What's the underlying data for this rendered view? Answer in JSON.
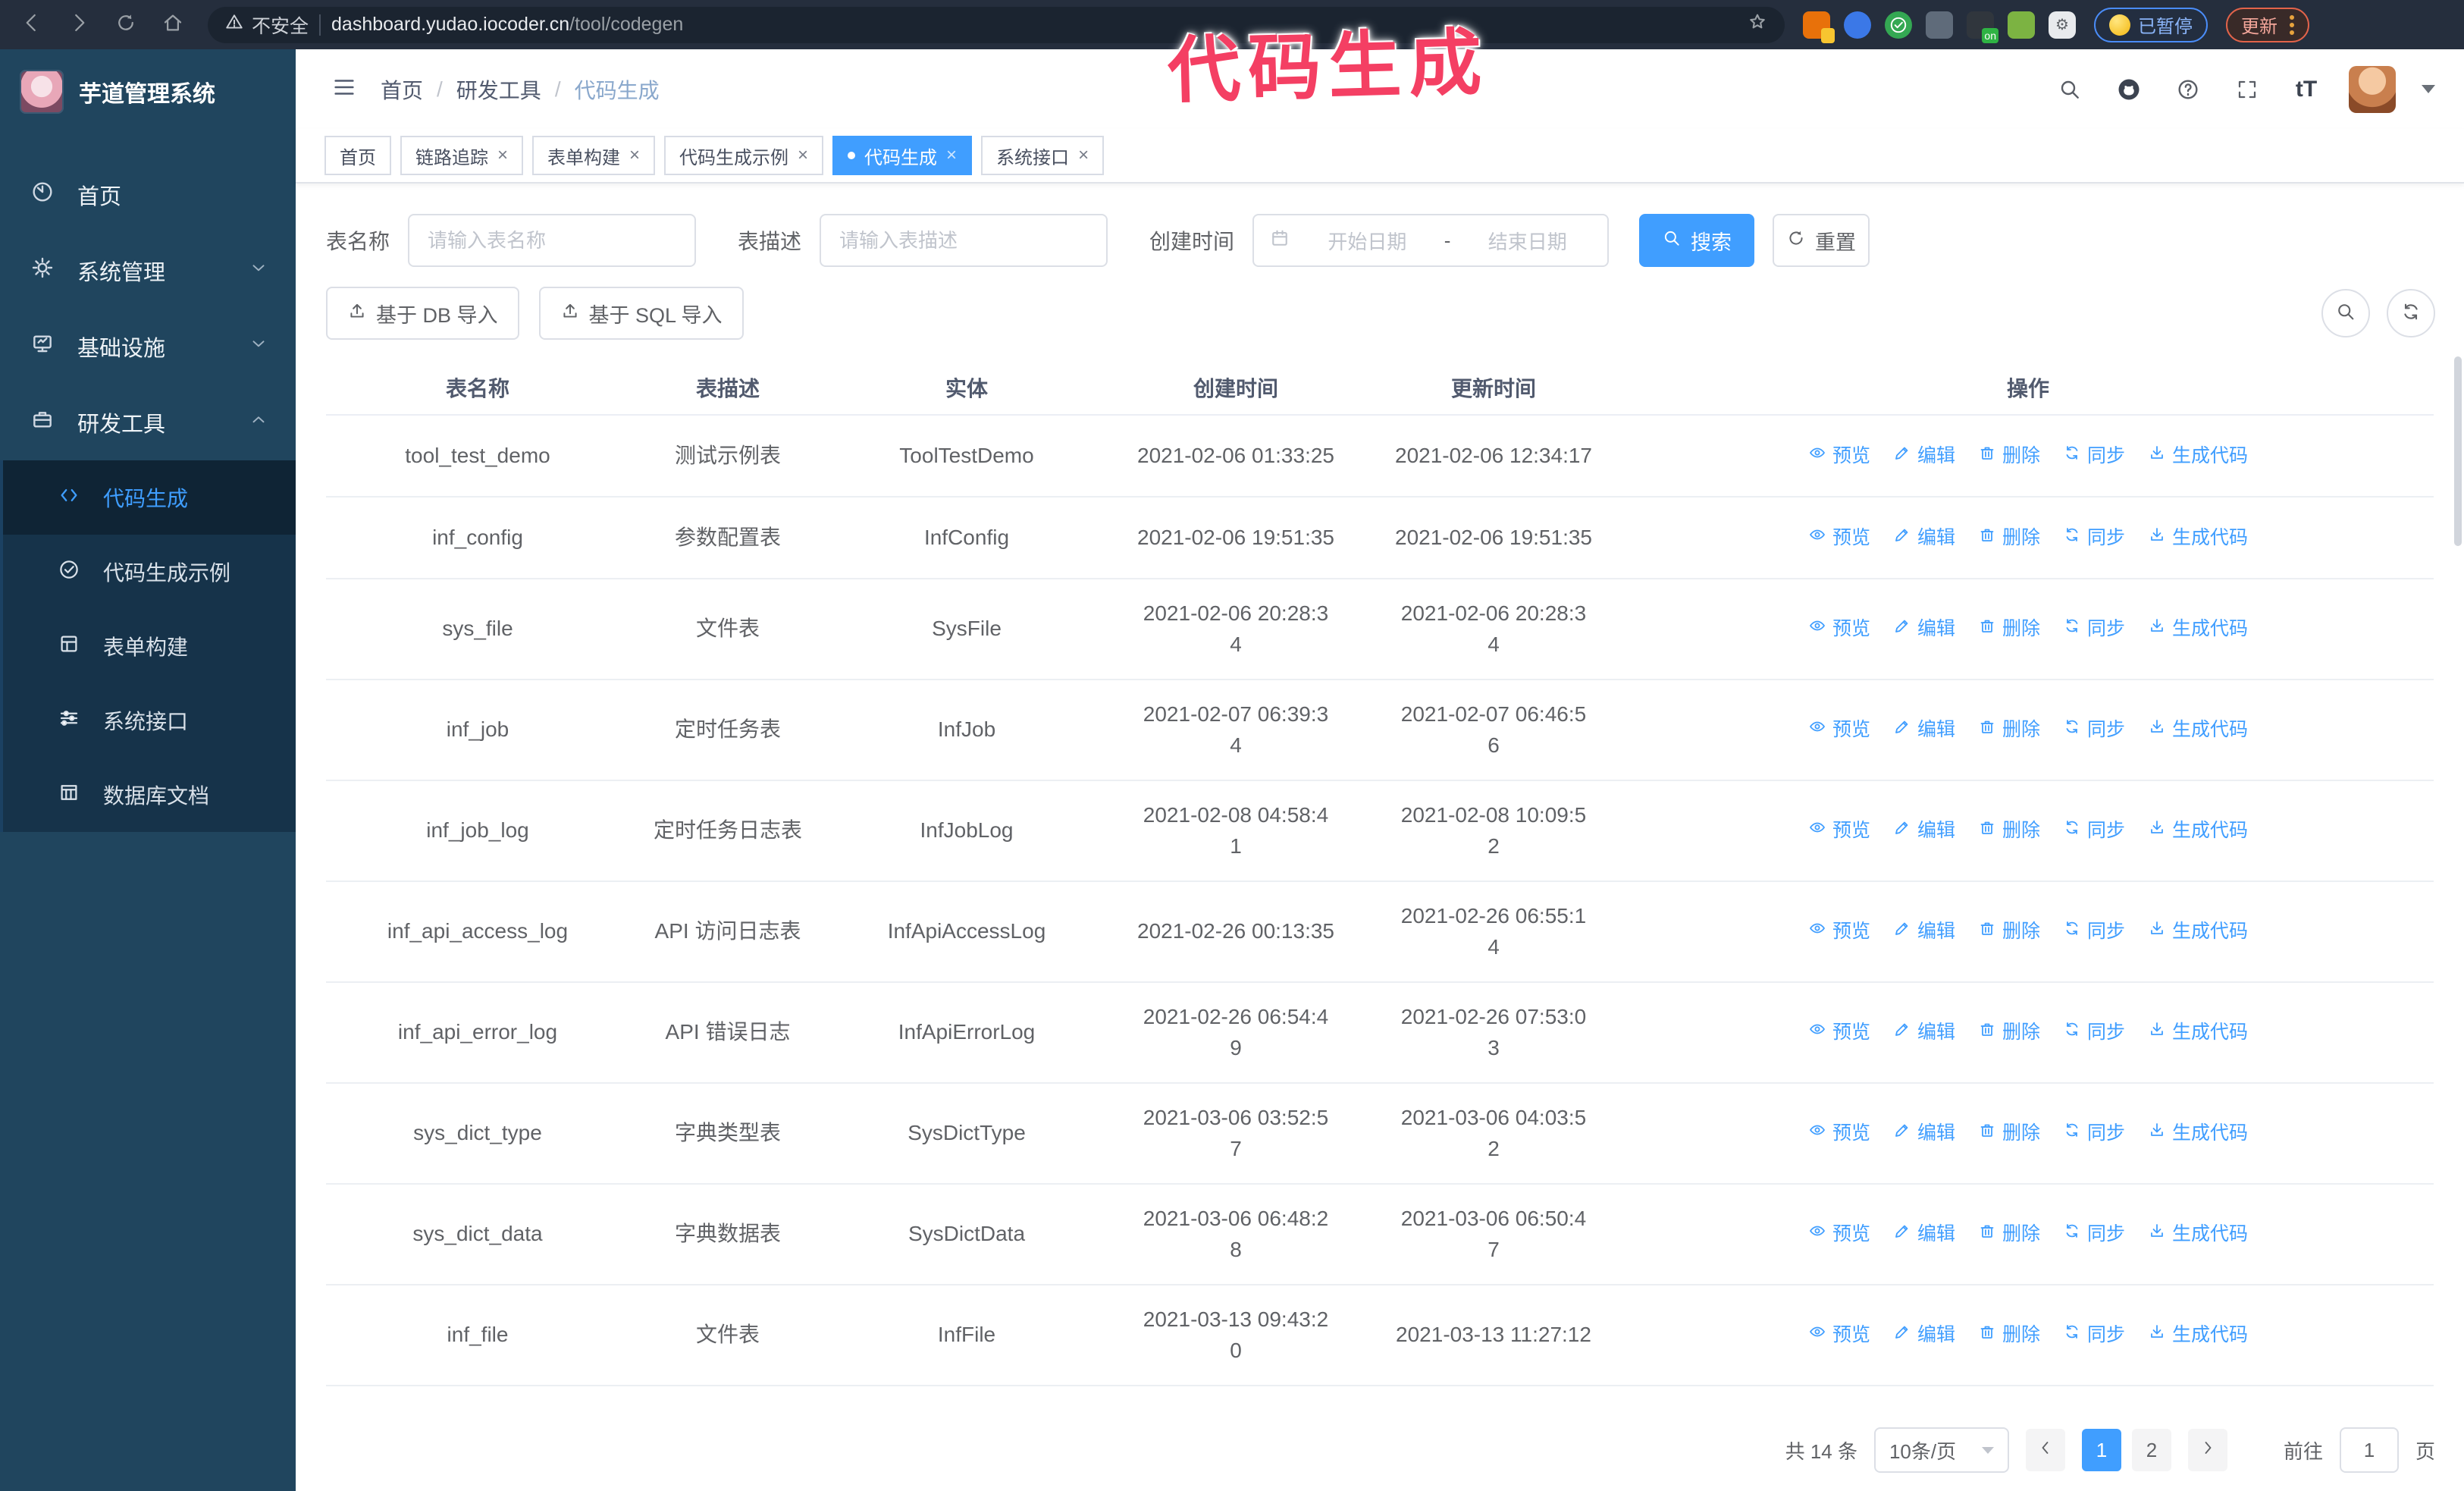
{
  "colors": {
    "accent": "#409eff",
    "annotation_pink": "#f43f63",
    "sidebar_bg": "#20455e",
    "submenu_bg": "#16334a",
    "browser_bar_bg": "#252e3d",
    "active_tab": "#409eff"
  },
  "annotation": {
    "text": "代码生成"
  },
  "browser": {
    "security_label": "不安全",
    "url_domain": "dashboard.yudao.iocoder.cn",
    "url_path": "/tool/codegen",
    "paused_button": "已暂停",
    "update_button": "更新",
    "extensions": [
      {
        "name": "extension-orange",
        "color": "#e8710a",
        "badge": "1",
        "badge_color": "#f7c530"
      },
      {
        "name": "extension-blue-gem",
        "color": "#3b78e7",
        "badge": "",
        "badge_color": ""
      },
      {
        "name": "extension-green-check",
        "color": "#34a853",
        "badge": "",
        "badge_color": ""
      },
      {
        "name": "extension-grid",
        "color": "#5f6b7a",
        "badge": "",
        "badge_color": "#4da3ff"
      },
      {
        "name": "extension-dark-on",
        "color": "#30363d",
        "badge": "on",
        "badge_color": "#2fb344"
      },
      {
        "name": "extension-green-bot",
        "color": "#7cb342",
        "badge": "",
        "badge_color": ""
      },
      {
        "name": "extension-puzzle",
        "color": "#e8eaed",
        "badge": "",
        "badge_color": ""
      }
    ]
  },
  "sidebar": {
    "title": "芋道管理系统",
    "items": [
      {
        "label": "首页",
        "icon": "dashboard-icon",
        "chevron": "",
        "active": false
      },
      {
        "label": "系统管理",
        "icon": "gear-icon",
        "chevron": "down",
        "active": false
      },
      {
        "label": "基础设施",
        "icon": "monitor-icon",
        "chevron": "down",
        "active": false
      },
      {
        "label": "研发工具",
        "icon": "briefcase-icon",
        "chevron": "up",
        "active": false
      }
    ],
    "submenu": [
      {
        "label": "代码生成",
        "icon": "code-icon",
        "active": true
      },
      {
        "label": "代码生成示例",
        "icon": "badge-check-icon",
        "active": false
      },
      {
        "label": "表单构建",
        "icon": "form-icon",
        "active": false
      },
      {
        "label": "系统接口",
        "icon": "sliders-icon",
        "active": false
      },
      {
        "label": "数据库文档",
        "icon": "database-icon",
        "active": false
      }
    ]
  },
  "breadcrumb": {
    "items": [
      "首页",
      "研发工具",
      "代码生成"
    ]
  },
  "tabs": [
    {
      "label": "首页",
      "closable": false,
      "active": false
    },
    {
      "label": "链路追踪",
      "closable": true,
      "active": false
    },
    {
      "label": "表单构建",
      "closable": true,
      "active": false
    },
    {
      "label": "代码生成示例",
      "closable": true,
      "active": false
    },
    {
      "label": "代码生成",
      "closable": true,
      "active": true
    },
    {
      "label": "系统接口",
      "closable": true,
      "active": false
    }
  ],
  "filters": {
    "table_name_label": "表名称",
    "table_name_placeholder": "请输入表名称",
    "table_desc_label": "表描述",
    "table_desc_placeholder": "请输入表描述",
    "create_time_label": "创建时间",
    "date_start_placeholder": "开始日期",
    "date_separator": "-",
    "date_end_placeholder": "结束日期",
    "search_button": "搜索",
    "reset_button": "重置"
  },
  "toolbar": {
    "import_db_button": "基于 DB 导入",
    "import_sql_button": "基于 SQL 导入"
  },
  "table": {
    "columns": [
      "表名称",
      "表描述",
      "实体",
      "创建时间",
      "更新时间",
      "操作"
    ],
    "actions": [
      "预览",
      "编辑",
      "删除",
      "同步",
      "生成代码"
    ],
    "rows": [
      {
        "name": "tool_test_demo",
        "desc": "测试示例表",
        "entity": "ToolTestDemo",
        "created": "2021-02-06 01:33:25",
        "updated": "2021-02-06 12:34:17",
        "created_wraps": false,
        "updated_wraps": false
      },
      {
        "name": "inf_config",
        "desc": "参数配置表",
        "entity": "InfConfig",
        "created": "2021-02-06 19:51:35",
        "updated": "2021-02-06 19:51:35",
        "created_wraps": false,
        "updated_wraps": false
      },
      {
        "name": "sys_file",
        "desc": "文件表",
        "entity": "SysFile",
        "created": "2021-02-06 20:28:34",
        "updated": "2021-02-06 20:28:34",
        "created_wraps": true,
        "updated_wraps": true
      },
      {
        "name": "inf_job",
        "desc": "定时任务表",
        "entity": "InfJob",
        "created": "2021-02-07 06:39:34",
        "updated": "2021-02-07 06:46:56",
        "created_wraps": true,
        "updated_wraps": true
      },
      {
        "name": "inf_job_log",
        "desc": "定时任务日志表",
        "entity": "InfJobLog",
        "created": "2021-02-08 04:58:41",
        "updated": "2021-02-08 10:09:52",
        "created_wraps": true,
        "updated_wraps": true
      },
      {
        "name": "inf_api_access_log",
        "desc": "API 访问日志表",
        "entity": "InfApiAccessLog",
        "created": "2021-02-26 00:13:35",
        "updated": "2021-02-26 06:55:14",
        "created_wraps": false,
        "updated_wraps": true
      },
      {
        "name": "inf_api_error_log",
        "desc": "API 错误日志",
        "entity": "InfApiErrorLog",
        "created": "2021-02-26 06:54:49",
        "updated": "2021-02-26 07:53:03",
        "created_wraps": true,
        "updated_wraps": true
      },
      {
        "name": "sys_dict_type",
        "desc": "字典类型表",
        "entity": "SysDictType",
        "created": "2021-03-06 03:52:57",
        "updated": "2021-03-06 04:03:52",
        "created_wraps": true,
        "updated_wraps": true
      },
      {
        "name": "sys_dict_data",
        "desc": "字典数据表",
        "entity": "SysDictData",
        "created": "2021-03-06 06:48:28",
        "updated": "2021-03-06 06:50:47",
        "created_wraps": true,
        "updated_wraps": true
      },
      {
        "name": "inf_file",
        "desc": "文件表",
        "entity": "InfFile",
        "created": "2021-03-13 09:43:20",
        "updated": "2021-03-13 11:27:12",
        "created_wraps": true,
        "updated_wraps": false
      }
    ]
  },
  "pagination": {
    "total_label": "共 14 条",
    "page_size_label": "10条/页",
    "pages": [
      "1",
      "2"
    ],
    "active_page": "1",
    "goto_label": "前往",
    "goto_value": "1",
    "unit_label": "页"
  }
}
